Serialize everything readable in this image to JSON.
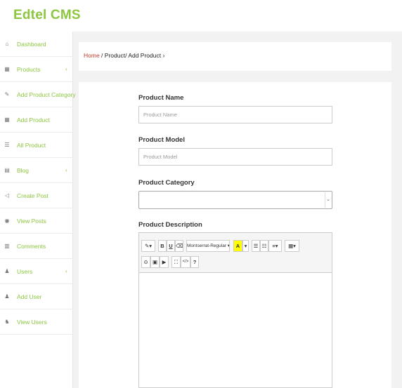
{
  "header": {
    "brand": "Edtel CMS"
  },
  "sidebar": {
    "items": [
      {
        "label": "Dashboard",
        "icon": "dashboard-icon",
        "glyph": "⌂"
      },
      {
        "label": "Products",
        "icon": "cart-icon",
        "glyph": "▦",
        "caret": "‹"
      },
      {
        "label": "Add Product Category",
        "icon": "edit-icon",
        "glyph": "✎"
      },
      {
        "label": "Add Product",
        "icon": "cart-icon",
        "glyph": "▦"
      },
      {
        "label": "All Product",
        "icon": "list-icon",
        "glyph": "☰"
      },
      {
        "label": "Blog",
        "icon": "newspaper-icon",
        "glyph": "▤",
        "caret": "‹"
      },
      {
        "label": "Create Post",
        "icon": "bullhorn-icon",
        "glyph": "◁"
      },
      {
        "label": "View Posts",
        "icon": "eye-icon",
        "glyph": "◉"
      },
      {
        "label": "Comments",
        "icon": "book-icon",
        "glyph": "▥"
      },
      {
        "label": "Users",
        "icon": "user-icon",
        "glyph": "♟",
        "caret": "‹"
      },
      {
        "label": "Add User",
        "icon": "user-plus-icon",
        "glyph": "♟"
      },
      {
        "label": "View Users",
        "icon": "users-icon",
        "glyph": "♞"
      }
    ]
  },
  "breadcrumb": {
    "home": "Home",
    "rest": " / Product/ Add Product",
    "chevron": "›"
  },
  "form": {
    "name_label": "Product Name",
    "name_placeholder": "Product Name",
    "model_label": "Product Model",
    "model_placeholder": "Product Model",
    "category_label": "Product Category",
    "category_value": "",
    "category_arrow": "⌄",
    "description_label": "Product Description"
  },
  "editor": {
    "toolbar": {
      "style": "✎▾",
      "bold": "B",
      "underline": "U",
      "eraser": "⌫",
      "font": "Montserrat-Regular ▾",
      "color": "A",
      "color_caret": "▾",
      "ul": "☰",
      "ol": "☷",
      "align": "≡▾",
      "table": "▦▾",
      "link": "⊝",
      "picture": "▣",
      "video": "▶",
      "fullscreen": "⛶",
      "code": "</>",
      "help": "?"
    }
  },
  "colors": {
    "accent": "#8dc63f",
    "home_link": "#c0392b",
    "highlight": "#ffff00"
  }
}
